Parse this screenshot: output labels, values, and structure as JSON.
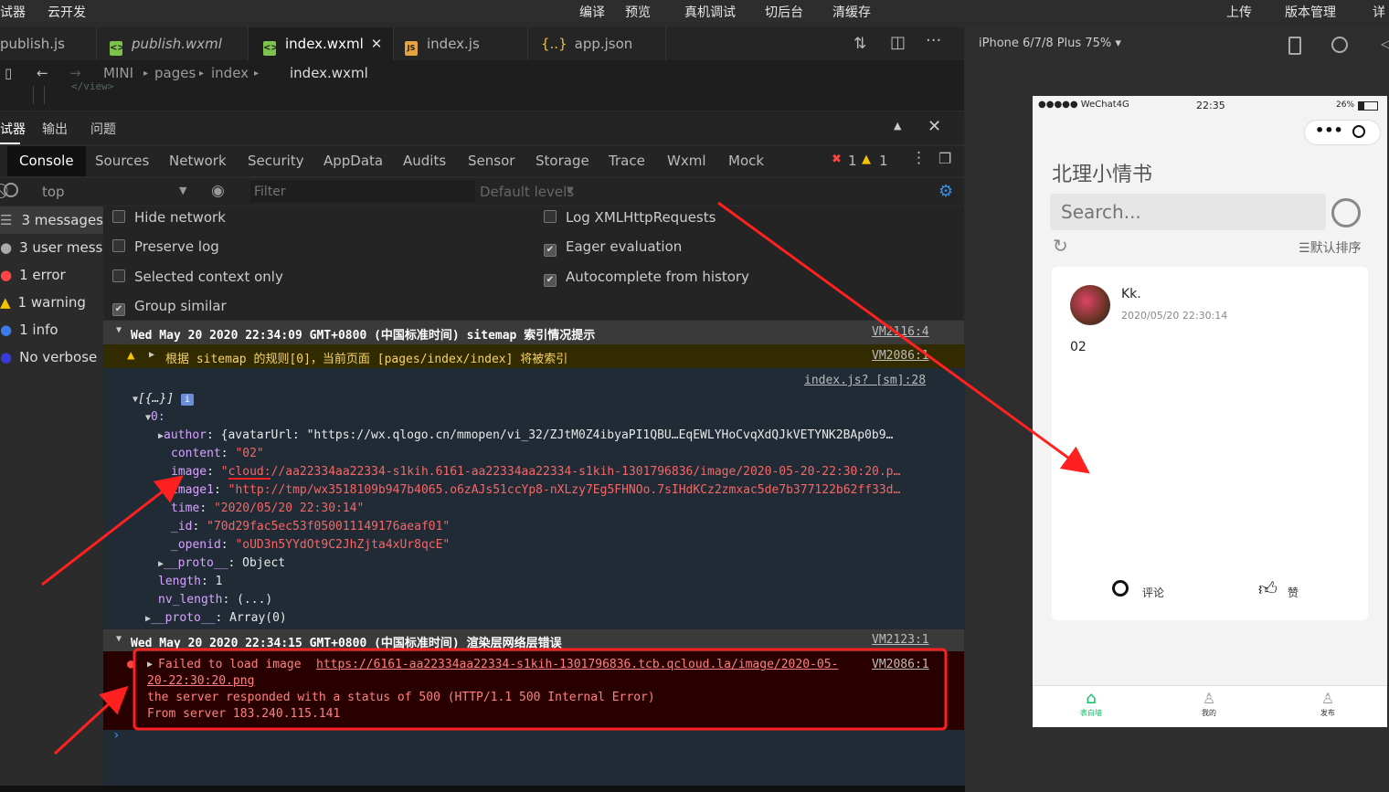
{
  "menu": {
    "left1": "试器",
    "left2": "云开发",
    "compile": "编译",
    "preview": "预览",
    "real_debug": "真机调试",
    "backend": "切后台",
    "clear_cache": "清缓存",
    "upload": "上传",
    "version": "版本管理",
    "detail": "详"
  },
  "tabs": [
    {
      "label": "publish.js",
      "icon": "js-icon"
    },
    {
      "label": "publish.wxml",
      "icon": "wxml-icon"
    },
    {
      "label": "index.wxml",
      "icon": "wxml-icon"
    },
    {
      "label": "index.js",
      "icon": "js-icon"
    },
    {
      "label": "app.json",
      "icon": "json-icon"
    }
  ],
  "breadcrumb": {
    "root": "MINI",
    "p1": "pages",
    "p2": "index",
    "file": "index.wxml"
  },
  "code_snippet": "</view>",
  "debugger": {
    "title": "试器",
    "output": "输出",
    "problems": "问题"
  },
  "devtools_tabs": [
    "Console",
    "Sources",
    "Network",
    "Security",
    "AppData",
    "Audits",
    "Sensor",
    "Storage",
    "Trace",
    "Wxml",
    "Mock"
  ],
  "badges": {
    "errors": "1",
    "warnings": "1"
  },
  "toolbar": {
    "context": "top",
    "filter_placeholder": "Filter",
    "levels": "Default levels"
  },
  "sidebar": [
    {
      "label": "3 messages",
      "icon": "list-icon"
    },
    {
      "label": "3 user mess...",
      "icon": "user-icon"
    },
    {
      "label": "1 error",
      "icon": "error-icon"
    },
    {
      "label": "1 warning",
      "icon": "warning-icon"
    },
    {
      "label": "1 info",
      "icon": "info-icon"
    },
    {
      "label": "No verbose",
      "icon": "bug-icon"
    }
  ],
  "settings": {
    "hide_network": "Hide network",
    "preserve_log": "Preserve log",
    "selected_context": "Selected context only",
    "group_similar": "Group similar",
    "log_xhr": "Log XMLHttpRequests",
    "eager_eval": "Eager evaluation",
    "autocomplete": "Autocomplete from history"
  },
  "console": {
    "group1": "Wed May 20 2020 22:34:09 GMT+0800 (中国标准时间) sitemap 索引情况提示",
    "group1_src": "VM2116:4",
    "warn": "根据 sitemap 的规则[0]，当前页面 [pages/index/index] 将被索引",
    "warn_src": "VM2086:1",
    "log_src": "index.js? [sm]:28",
    "arr": "[{…}]",
    "idx": "0:",
    "author_key": "author",
    "author_val": "{avatarUrl: \"https://wx.qlogo.cn/mmopen/vi_32/ZJtM0Z4ibyaPI1QBU…EqEWLYHoCvqXdQJkVETYNK2BAp0b9…",
    "content_key": "content",
    "content_val": "\"02\"",
    "image_key": "image",
    "image_val": "\"cloud://aa22334aa22334-s1kih.6161-aa22334aa22334-s1kih-1301796836/image/2020-05-20-22:30:20.p…",
    "image1_key": "image1",
    "image1_val": "\"http://tmp/wx3518109b947b4065.o6zAJs51ccYp8-nXLzy7Eg5FHNOo.7sIHdKCz2zmxac5de7b377122b62ff33d…",
    "time_key": "time",
    "time_val": "\"2020/05/20 22:30:14\"",
    "id_key": "_id",
    "id_val": "\"70d29fac5ec53f050011149176aeaf01\"",
    "openid_key": "_openid",
    "openid_val": "\"oUD3n5YYdOt9C2JhZjta4xUr8qcE\"",
    "proto_key": "__proto__",
    "proto_val": "Object",
    "length_key": "length",
    "length_val": "1",
    "nvlen_key": "nv_length",
    "nvlen_val": "(...)",
    "proto2_key": "__proto__",
    "proto2_val": "Array(0)",
    "group2": "Wed May 20 2020 22:34:15 GMT+0800 (中国标准时间) 渲染层网络层错误",
    "group2_src": "VM2123:1",
    "err_line1": "Failed to load image",
    "err_url1": "https://6161-aa22334aa22334-s1kih-1301796836.tcb.qcloud.la/image/2020-05-",
    "err_url2": "20-22:30:20.png",
    "err_src": "VM2086:1",
    "err_line2": "the server responded with a status of 500 (HTTP/1.1 500 Internal Error)",
    "err_line3": "From server 183.240.115.141"
  },
  "simulator": {
    "device": "iPhone 6/7/8 Plus 75% ▾"
  },
  "phone": {
    "carrier": "●●●●● WeChat4G",
    "time": "22:35",
    "battery": "26%",
    "title": "北理小情书",
    "search_placeholder": "Search...",
    "sort": "默认排序",
    "post": {
      "user": "Kk.",
      "date": "2020/05/20 22:30:14",
      "content": "02",
      "comment": "评论",
      "like": "赞"
    },
    "tabbar": [
      "表白墙",
      "我的",
      "发布"
    ]
  },
  "colors": {
    "accent_green": "#07c160",
    "error_bg": "#290000",
    "arrow_red": "#ff2020"
  }
}
